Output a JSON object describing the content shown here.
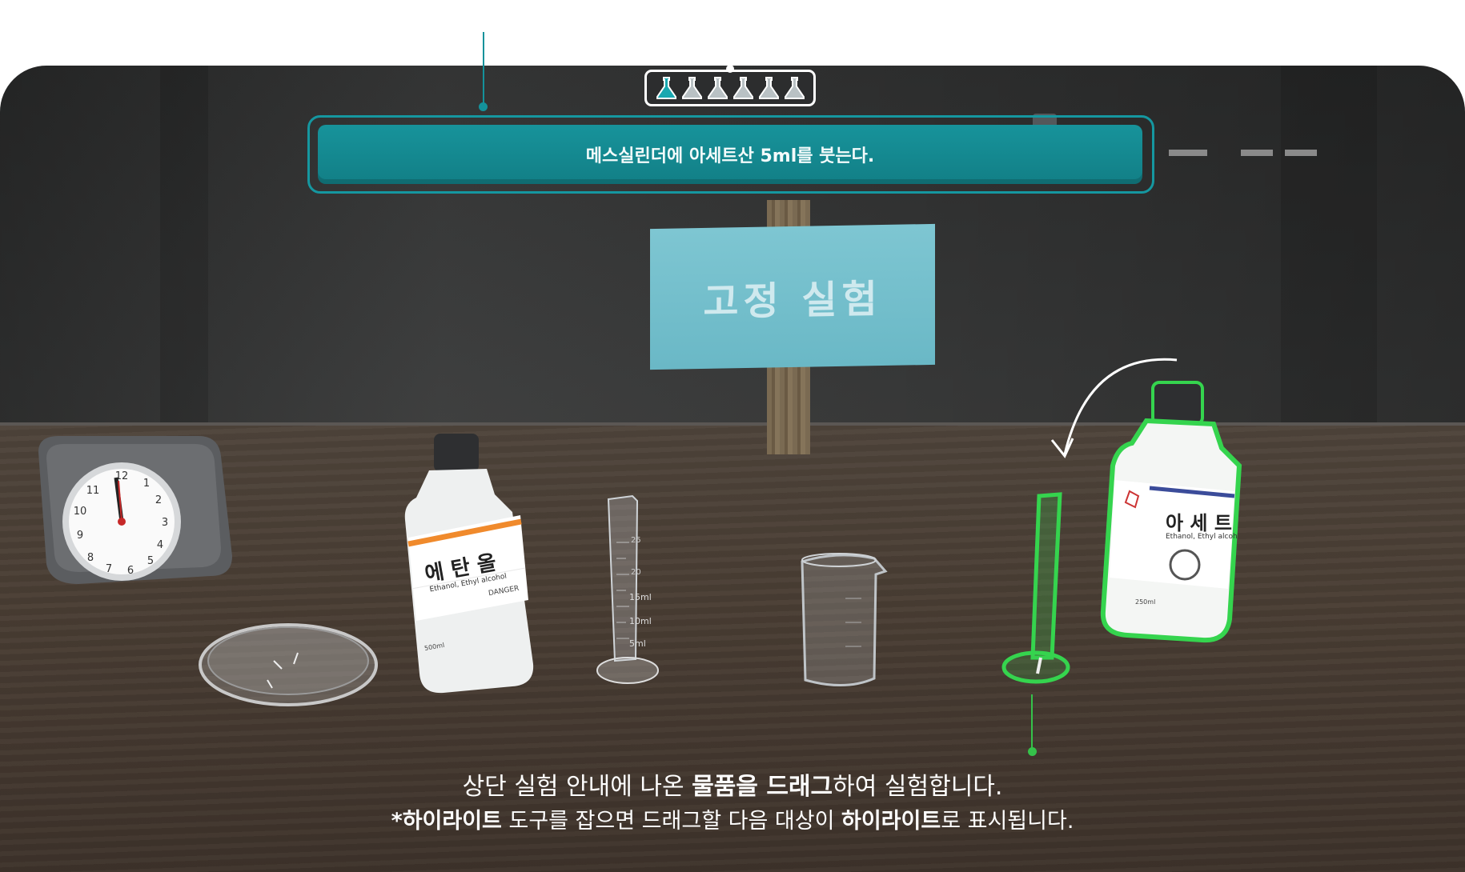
{
  "instruction": {
    "text": "메스실린더에 아세트산 5ml를 붓는다."
  },
  "progress": {
    "total_steps": 6,
    "current_step": 1
  },
  "sign": {
    "text": "고정 실험"
  },
  "bottles": {
    "ethanol": {
      "name": "에 탄 올",
      "subtitle": "Ethanol, Ethyl alcohol",
      "warning": "DANGER",
      "volume": "500ml"
    },
    "acetic": {
      "name": "아 세 트",
      "subtitle": "Ethanol, Ethyl alcoh",
      "volume": "250ml"
    }
  },
  "cylinder": {
    "marks": [
      "25",
      "20",
      "15ml",
      "10ml",
      "5ml"
    ]
  },
  "help": {
    "line1_a": "상단 실험 안내에 나온 ",
    "line1_b": "물품을 드래그",
    "line1_c": "하여 실험합니다.",
    "line2_a": "*",
    "line2_b": "하이라이트",
    "line2_c": " 도구를 잡으면 드래그할 다음 대상이 ",
    "line2_d": "하이라이트",
    "line2_e": "로 표시됩니다."
  },
  "colors": {
    "accent": "#14929b",
    "highlight": "#35c24a",
    "banner": "#138a92"
  }
}
